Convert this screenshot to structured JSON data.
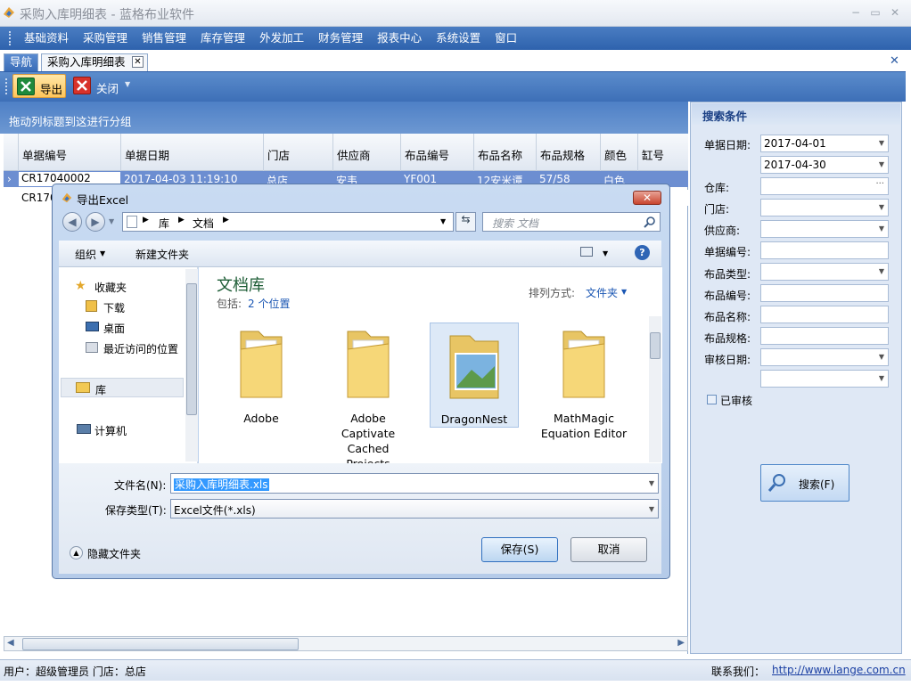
{
  "window": {
    "title": "采购入库明细表 - 蓝格布业软件"
  },
  "menu": [
    "基础资料",
    "采购管理",
    "销售管理",
    "库存管理",
    "外发加工",
    "财务管理",
    "报表中心",
    "系统设置",
    "窗口"
  ],
  "tabs": {
    "nav": "导航",
    "doc": "采购入库明细表",
    "close": "✕",
    "panel_close": "✕"
  },
  "toolbar": {
    "export": "导出",
    "close": "关闭"
  },
  "grid": {
    "group_hint": "拖动列标题到这进行分组",
    "columns": [
      "单据编号",
      "单据日期",
      "门店",
      "供应商",
      "布品编号",
      "布品名称",
      "布品规格",
      "颜色",
      "缸号"
    ],
    "rows": [
      [
        "CR17040002",
        "2017-04-03 11:19:10",
        "总店",
        "安韦",
        "YF001",
        "12安米谭",
        "57/58",
        "白色",
        ""
      ],
      [
        "CR170",
        "",
        "",
        "",
        "",
        "",
        "",
        "",
        ""
      ]
    ]
  },
  "search": {
    "title": "搜索条件",
    "labels": [
      "单据日期:",
      "仓库:",
      "门店:",
      "供应商:",
      "单据编号:",
      "布品类型:",
      "布品编号:",
      "布品名称:",
      "布品规格:",
      "审核日期:"
    ],
    "date_from": "2017-04-01",
    "date_to": "2017-04-30",
    "warehouse_btn": "···",
    "checkbox": "已审核",
    "button": "搜索(F)"
  },
  "status": {
    "user": "用户：超级管理员  门店：总店",
    "contact": "联系我们：",
    "link": "http://www.lange.com.cn"
  },
  "dialog": {
    "title": "导出Excel",
    "path": [
      "库",
      "文档"
    ],
    "search_placeholder": "搜索 文档",
    "organize": "组织",
    "new_folder": "新建文件夹",
    "help": "?",
    "nav": {
      "favorites": "收藏夹",
      "downloads": "下载",
      "desktop": "桌面",
      "recent": "最近访问的位置",
      "library": "库",
      "computer": "计算机"
    },
    "library_title": "文档库",
    "includes_label": "包括:",
    "includes_link": "2 个位置",
    "sort_label": "排列方式:",
    "sort_value": "文件夹",
    "folders": [
      {
        "name": "Adobe"
      },
      {
        "name": "Adobe Captivate Cached Projects"
      },
      {
        "name": "DragonNest"
      },
      {
        "name": "MathMagic Equation Editor"
      }
    ],
    "filename_label": "文件名(N):",
    "filename": "采购入库明细表.xls",
    "filetype_label": "保存类型(T):",
    "filetype": "Excel文件(*.xls)",
    "hide_folders": "隐藏文件夹",
    "save": "保存(S)",
    "cancel": "取消"
  },
  "colors": {
    "menu": "#3a6db8",
    "selection": "#6c8ed1",
    "link": "#1a3fa3"
  }
}
